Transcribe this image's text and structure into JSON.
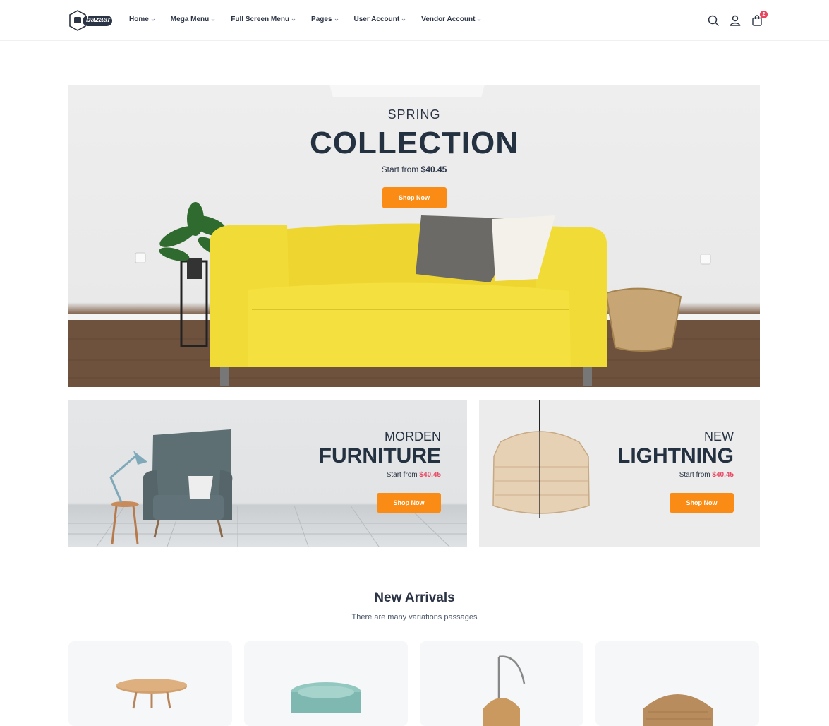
{
  "header": {
    "logo_text": "bazaar",
    "nav": [
      {
        "label": "Home"
      },
      {
        "label": "Mega Menu"
      },
      {
        "label": "Full Screen Menu"
      },
      {
        "label": "Pages"
      },
      {
        "label": "User Account"
      },
      {
        "label": "Vendor Account"
      }
    ],
    "icons": [
      "search-icon",
      "user-icon",
      "shopping-bag-icon"
    ],
    "cart_count": "2"
  },
  "hero": {
    "kicker": "SPRING",
    "title": "COLLECTION",
    "sub_prefix": "Start from",
    "price": "$40.45",
    "button": "Shop Now"
  },
  "promos": [
    {
      "kicker": "MORDEN",
      "title": "FURNITURE",
      "sub_prefix": "Start from",
      "price": "$40.45",
      "button": "Shop Now"
    },
    {
      "kicker": "NEW",
      "title": "LIGHTNING",
      "sub_prefix": "Start from",
      "price": "$40.45",
      "button": "Shop Now"
    }
  ],
  "arrivals": {
    "title": "New Arrivals",
    "subtitle": "There are many variations passages"
  },
  "colors": {
    "accent": "#fa8c16",
    "price": "#e94560",
    "text": "#2b3445",
    "sofa": "#f3df3a"
  }
}
